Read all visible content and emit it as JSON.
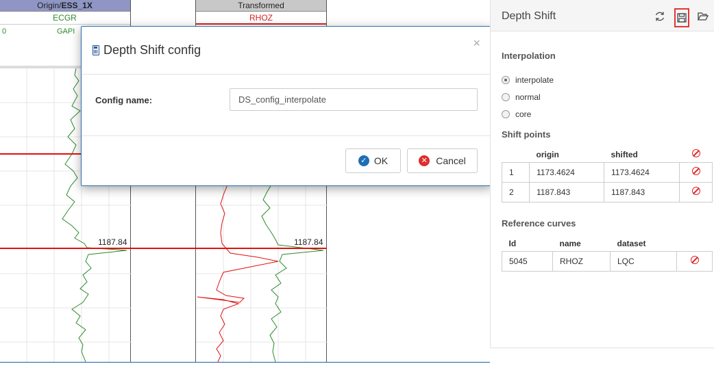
{
  "tracks": {
    "left": {
      "title_prefix": "Origin/",
      "title_bold": "ESS_1X",
      "curve": "ECGR",
      "min": "0",
      "unit": "GAPI",
      "depth_label": "1187.84"
    },
    "right": {
      "title": "Transformed",
      "curve": "RHOZ",
      "depth_label": "1187.84"
    }
  },
  "dialog": {
    "title": "Depth Shift config",
    "close": "×",
    "field_label": "Config name:",
    "field_value": "DS_config_interpolate",
    "ok_label": "OK",
    "cancel_label": "Cancel"
  },
  "side": {
    "title": "Depth Shift",
    "interpolation_title": "Interpolation",
    "options": [
      {
        "label": "interpolate",
        "checked": true
      },
      {
        "label": "normal",
        "checked": false
      },
      {
        "label": "core",
        "checked": false
      }
    ],
    "shift_title": "Shift points",
    "shift_headers": [
      "",
      "origin",
      "shifted"
    ],
    "shift_rows": [
      {
        "idx": "1",
        "origin": "1173.4624",
        "shifted": "1173.4624"
      },
      {
        "idx": "2",
        "origin": "1187.843",
        "shifted": "1187.843"
      }
    ],
    "ref_title": "Reference curves",
    "ref_headers": [
      "Id",
      "name",
      "dataset"
    ],
    "ref_rows": [
      {
        "id": "5045",
        "name": "RHOZ",
        "dataset": "LQC"
      }
    ]
  },
  "colors": {
    "curve_green": "#2b8a2b",
    "curve_red": "#e01010",
    "dialog_border": "#2a6fb0",
    "ok_icon": "#1e6fb4",
    "cancel_icon": "#e02d2d",
    "highlight": "#e53333"
  }
}
